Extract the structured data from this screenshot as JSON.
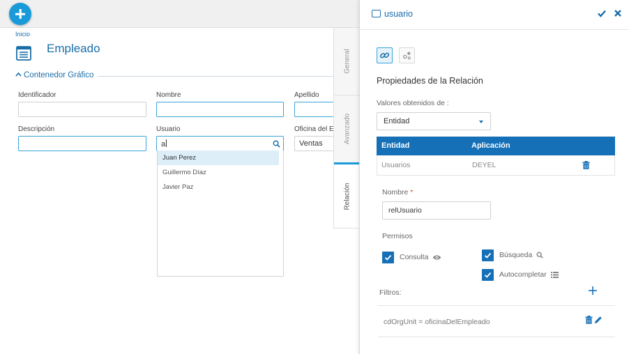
{
  "header": {
    "fab_icon": "plus-icon",
    "fab_color": "#1a9ad9"
  },
  "form": {
    "breadcrumb": "Inicio",
    "title": "Empleado",
    "title_icon": "form-list-icon",
    "section": "Contenedor Gráfico",
    "fields": {
      "identificador": {
        "label": "Identificador",
        "value": ""
      },
      "nombre": {
        "label": "Nombre",
        "value": ""
      },
      "apellido": {
        "label": "Apellido",
        "value": ""
      },
      "descripcion": {
        "label": "Descripción",
        "value": ""
      },
      "usuario": {
        "label": "Usuario",
        "value": "a"
      },
      "oficina": {
        "label": "Oficina del E",
        "value": "Ventas"
      }
    },
    "usuario_suggestions": [
      "Juan Perez",
      "Guillermo Díaz",
      "Javier Paz"
    ]
  },
  "tabs": [
    {
      "label": "General",
      "active": false
    },
    {
      "label": "Avanzado",
      "active": false
    },
    {
      "label": "Relación",
      "active": true
    }
  ],
  "panel": {
    "title": "usuario",
    "confirm_icon": "check-icon",
    "close_icon": "close-icon",
    "section_title": "Propiedades de la Relación",
    "valores_label": "Valores obtenidos de :",
    "valores_selected": "Entidad",
    "table": {
      "headers": [
        "Entidad",
        "Aplicación"
      ],
      "rows": [
        {
          "entidad": "Usuarios",
          "aplicacion": "DEYEL"
        }
      ]
    },
    "nombre_label": "Nombre",
    "nombre_required": "*",
    "nombre_value": "relUsuario",
    "permisos_label": "Permisos",
    "permisos": {
      "consulta": {
        "label": "Consulta",
        "checked": true
      },
      "busqueda": {
        "label": "Búsqueda",
        "checked": true
      },
      "autocompletar": {
        "label": "Autocompletar",
        "checked": true
      }
    },
    "filtros_label": "Filtros:",
    "filtros": [
      "cdOrgUnit = oficinaDelEmpleado"
    ]
  },
  "colors": {
    "accent": "#1a9ad9",
    "primary": "#1570b7",
    "link": "#1a6ea8"
  }
}
